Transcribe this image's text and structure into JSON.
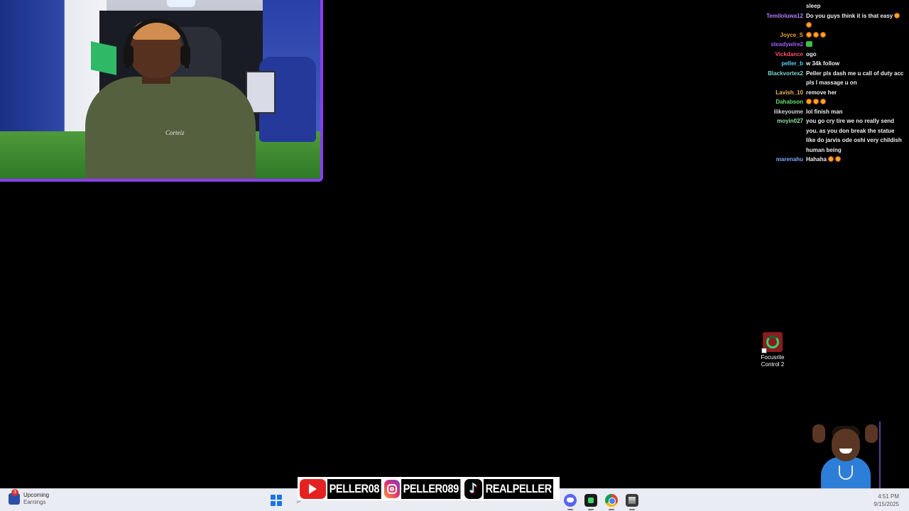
{
  "chat": {
    "messages": [
      {
        "user": "",
        "color": "#ffffff",
        "text": "sleep",
        "emotes": 0
      },
      {
        "user": "Temiloluwa12",
        "color": "#b57cff",
        "text": "Do you guys think it is that easy",
        "emotes": 1
      },
      {
        "user": "",
        "color": "#ffffff",
        "text": "",
        "emotes": 1
      },
      {
        "user": "Joyce_S",
        "color": "#f0a431",
        "text": "",
        "emotes": 3
      },
      {
        "user": "steadywire2",
        "color": "#a25cff",
        "text": "",
        "emotes": 0,
        "green_emote": true
      },
      {
        "user": "Vickdance",
        "color": "#ff4f6d",
        "text": "ogo",
        "emotes": 0
      },
      {
        "user": "peller_b",
        "color": "#5ad1ff",
        "text": "w 34k follow",
        "emotes": 0
      },
      {
        "user": "Blackvortex2",
        "color": "#7fd9d0",
        "text": "Peller pls dash me u call of duty acc",
        "emotes": 0
      },
      {
        "user": "",
        "color": "#ffffff",
        "text": "pls I massage u on",
        "emotes": 0
      },
      {
        "user": "Lavish_10",
        "color": "#f6b45a",
        "text": "remove her",
        "emotes": 0
      },
      {
        "user": "Dahabson",
        "color": "#67e26f",
        "text": "",
        "emotes": 3
      },
      {
        "user": "ilikeyoume",
        "color": "#d8d8d8",
        "text": "lol finish man",
        "emotes": 0
      },
      {
        "user": "moyin027",
        "color": "#8fe3a0",
        "text": "you go cry tire we no really send",
        "emotes": 0
      },
      {
        "user": "",
        "color": "#ffffff",
        "text": "you. as you don break the statue",
        "emotes": 0
      },
      {
        "user": "",
        "color": "#ffffff",
        "text": "like do jarvis ode oshi very childish",
        "emotes": 0
      },
      {
        "user": "",
        "color": "#ffffff",
        "text": "human being",
        "emotes": 0
      },
      {
        "user": "marenahu",
        "color": "#7ea7ff",
        "text": "Hahaha",
        "emotes": 2
      }
    ]
  },
  "webcam": {
    "shirt_logo": "Corteiz"
  },
  "desktop": {
    "focusrite_label_line1": "Focusrite",
    "focusrite_label_line2": "Control 2"
  },
  "socials": {
    "youtube": "PELLER08",
    "instagram": "PELLER089",
    "tiktok": "REALPELLER"
  },
  "taskbar": {
    "weather_badge": "3",
    "weather_title": "Upcoming",
    "weather_sub": "Earnings",
    "time": "4:51 PM",
    "date": "9/15/2025"
  },
  "colors": {
    "webcam_border": "#8a3df0",
    "youtube_red": "#e52222",
    "taskbar_bg": "#e9ecf2"
  }
}
